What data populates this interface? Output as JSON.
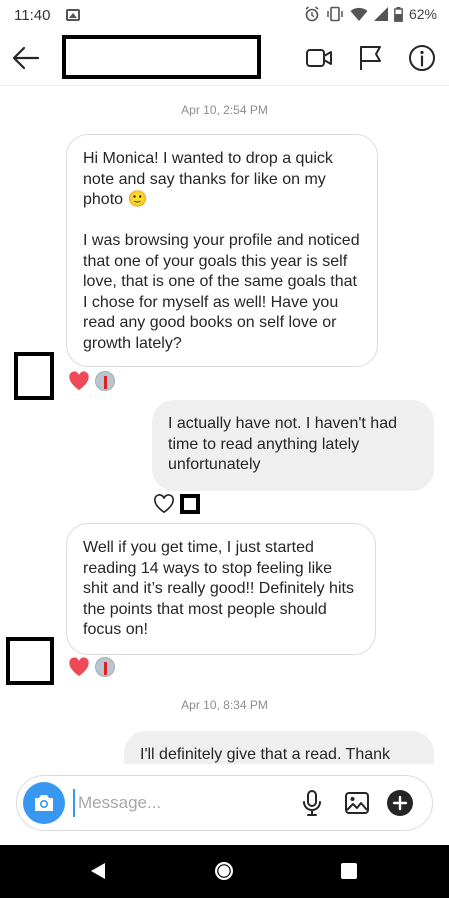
{
  "status_bar": {
    "time": "11:40",
    "battery": "62%",
    "icons": [
      "image-icon",
      "alarm-icon",
      "vibrate-icon",
      "wifi-icon",
      "signal-icon",
      "battery-icon"
    ]
  },
  "header": {
    "icons": [
      "back-arrow-icon",
      "video-call-icon",
      "flag-icon",
      "info-icon"
    ]
  },
  "chat": {
    "messages": [
      {
        "type": "timestamp",
        "text": "Apr 10, 2:54 PM"
      },
      {
        "type": "incoming",
        "text": "Hi Monica! I wanted to drop a quick note and say thanks for like on my photo 🙂\n\nI was browsing your profile and noticed that one of your goals this year is self love, that is one of the same goals that I chose for myself as well! Have you read any good books on self love or growth lately?",
        "reaction": "heart-filled-icon"
      },
      {
        "type": "outgoing",
        "text": "I actually have not. I haven't had time to read anything lately unfortunately",
        "reaction": "heart-outline-icon"
      },
      {
        "type": "incoming",
        "text": "Well if you get time, I just started reading 14 ways to stop feeling like shit and it’s really good!! Definitely hits the points that most people should focus on!",
        "reaction": "heart-filled-icon"
      },
      {
        "type": "timestamp",
        "text": "Apr 10, 8:34 PM"
      },
      {
        "type": "outgoing",
        "text": "I'll definitely give that a read. Thank"
      }
    ]
  },
  "composer": {
    "placeholder": "Message...",
    "icons": [
      "camera-icon",
      "microphone-icon",
      "gallery-icon",
      "add-icon"
    ]
  },
  "nav_bar": {
    "icons": [
      "back-triangle-icon",
      "home-circle-icon",
      "recents-square-icon"
    ]
  },
  "colors": {
    "accent": "#3897f0",
    "heart": "#ed4956",
    "outgoing_bubble": "#efefef",
    "incoming_border": "#dbdbdb",
    "timestamp": "#8e8e8e"
  }
}
